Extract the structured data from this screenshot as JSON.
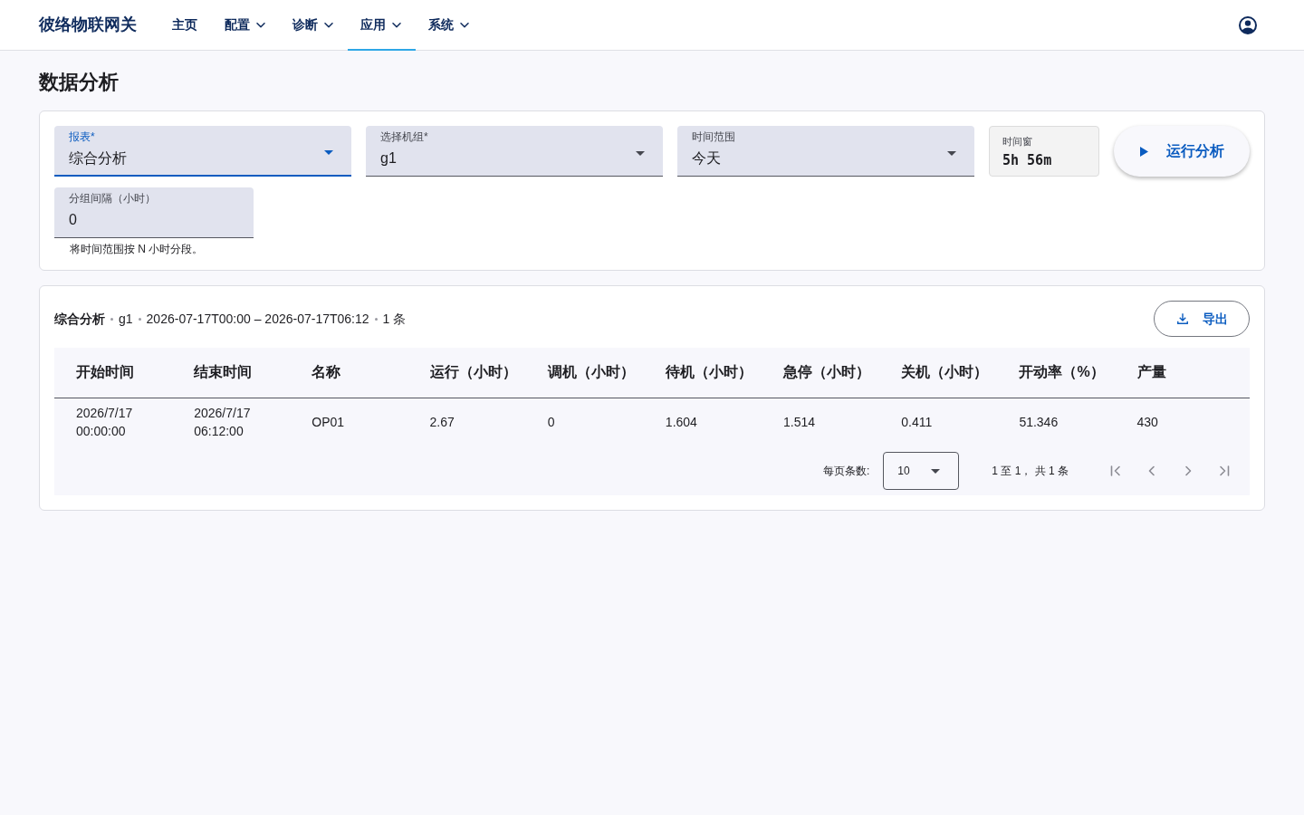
{
  "navbar": {
    "brand": "彼络物联网关",
    "items": [
      {
        "label": "主页",
        "dropdown": false,
        "selected": false
      },
      {
        "label": "配置",
        "dropdown": true,
        "selected": false
      },
      {
        "label": "诊断",
        "dropdown": true,
        "selected": false
      },
      {
        "label": "应用",
        "dropdown": true,
        "selected": true
      },
      {
        "label": "系统",
        "dropdown": true,
        "selected": false
      }
    ]
  },
  "page_title": "数据分析",
  "filters": {
    "fields": [
      {
        "kind": "select",
        "label": "报表*",
        "value": "综合分析",
        "focused": true
      },
      {
        "kind": "select",
        "label": "选择机组*",
        "value": "g1",
        "focused": false
      },
      {
        "kind": "select",
        "label": "时间范围",
        "value": "今天",
        "focused": false
      },
      {
        "kind": "readout",
        "label": "时间窗",
        "value": "5h 56m"
      }
    ],
    "run_button": {
      "label": "运行分析"
    },
    "interval_field": {
      "kind": "text",
      "label": "分组间隔（小时）",
      "value": "0",
      "focused": false,
      "helper": "将时间范围按 N 小时分段。"
    }
  },
  "results": {
    "summary": {
      "report": "综合分析",
      "group": "g1",
      "range": "2026-07-17T00:00 – 2026-07-17T06:12",
      "count": "1 条"
    },
    "export_button": {
      "label": "导出"
    },
    "table": {
      "columns": [
        "开始时间",
        "结束时间",
        "名称",
        "运行（小时）",
        "调机（小时）",
        "待机（小时）",
        "急停（小时）",
        "关机（小时）",
        "开动率（%）",
        "产量"
      ],
      "rows": [
        [
          "2026/7/17 00:00:00",
          "2026/7/17 06:12:00",
          "OP01",
          "2.67",
          "0",
          "1.604",
          "1.514",
          "0.411",
          "51.346",
          "430"
        ]
      ]
    },
    "pagination": {
      "page_size_label": "每页条数:",
      "page_size": "10",
      "range_text": "1 至 1， 共 1 条",
      "buttons": [
        {
          "kind": "first",
          "disabled": true
        },
        {
          "kind": "prev",
          "disabled": true
        },
        {
          "kind": "next",
          "disabled": true
        },
        {
          "kind": "last",
          "disabled": true
        }
      ]
    }
  }
}
